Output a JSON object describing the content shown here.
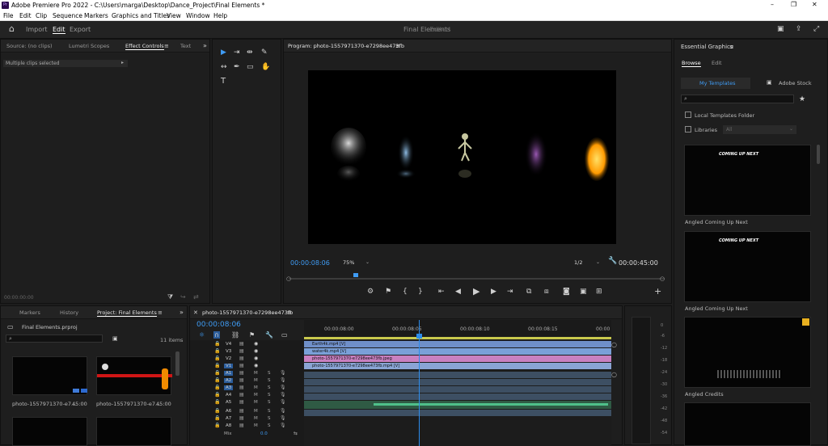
{
  "window": {
    "title": "Adobe Premiere Pro 2022 - C:\\Users\\marga\\Desktop\\Dance_Project\\Final Elements *",
    "app_icon": "Pr"
  },
  "menu": [
    "File",
    "Edit",
    "Clip",
    "Sequence",
    "Markers",
    "Graphics and Titles",
    "View",
    "Window",
    "Help"
  ],
  "workspace": {
    "import": "Import",
    "edit": "Edit",
    "export": "Export",
    "project_name": "Final Elements",
    "status": "- Edited"
  },
  "source_panel": {
    "tabs": [
      "Source: (no clips)",
      "Lumetri Scopes",
      "Effect Controls",
      "Text"
    ],
    "selected_text": "Multiple clips selected",
    "timecode": "00:00:00:00"
  },
  "program": {
    "title": "Program: photo-1557971370-e7298ee473fb",
    "timecode": "00:00:08:06",
    "zoom": "75%",
    "quality": "1/2",
    "duration": "00:00:45:00"
  },
  "project_panel": {
    "tabs": [
      "Markers",
      "History",
      "Project: Final Elements"
    ],
    "file": "Final Elements.prproj",
    "items_count": "11 items",
    "clips": [
      {
        "name": "photo-1557971370-e7...",
        "duration": "45:00"
      },
      {
        "name": "photo-1557971370-e7...",
        "duration": "45:00"
      }
    ]
  },
  "timeline": {
    "tab": "photo-1557971370-e7298ee473fb",
    "timecode": "00:00:08:06",
    "ruler": [
      "00:00:08:00",
      "00:00:08:05",
      "00:00:08:10",
      "00:00:08:15",
      "00:00"
    ],
    "video_tracks": [
      "V4",
      "V3",
      "V2",
      "V1"
    ],
    "audio_tracks": [
      "A1",
      "A2",
      "A3",
      "A4",
      "A5",
      "A6",
      "A7",
      "A8"
    ],
    "mix_label": "Mix",
    "mix_value": "0.0",
    "v_source": "V1",
    "clips": [
      {
        "label": "Earth4k.mp4 [V]",
        "track": "V4",
        "color": "#6f8fc9"
      },
      {
        "label": "water4k.mp4 [V]",
        "track": "V3",
        "color": "#7aa0d8"
      },
      {
        "label": "photo-1557971370-e7298ee473fb.jpeg",
        "track": "V2",
        "color": "#c980c0"
      },
      {
        "label": "photo-1557971370-e7298ee473fb.mp4 [V]",
        "track": "V1",
        "color": "#8aa4d4"
      }
    ]
  },
  "meter": {
    "ticks": [
      "0",
      "-6",
      "-12",
      "-18",
      "-24",
      "-30",
      "-36",
      "-42",
      "-48",
      "-54"
    ]
  },
  "essential_graphics": {
    "title": "Essential Graphics",
    "tabs": [
      "Browse",
      "Edit"
    ],
    "subtabs": [
      "My Templates",
      "Adobe Stock"
    ],
    "local_templates": "Local Templates Folder",
    "libraries": "Libraries",
    "libraries_value": "All",
    "templates": [
      {
        "name": "Angled Coming Up Next",
        "overlay": "COMING UP NEXT"
      },
      {
        "name": "Angled Coming Up Next",
        "overlay": "COMING UP NEXT"
      },
      {
        "name": "Angled Credits",
        "overlay": ""
      }
    ]
  },
  "colors": {
    "accent": "#3f9cf5",
    "panel_bg": "#1e1e1e",
    "playhead": "#2d8ceb"
  }
}
